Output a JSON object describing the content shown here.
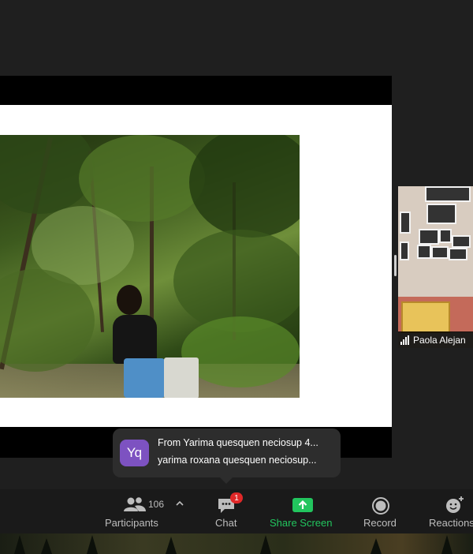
{
  "video": {
    "participant_name": "Paola Alejan"
  },
  "notification": {
    "avatar_initials": "Yq",
    "line1": "From Yarima quesquen neciosup 4...",
    "line2": "yarima roxana quesquen neciosup..."
  },
  "toolbar": {
    "participants_label": "Participants",
    "participants_count": "106",
    "chat_label": "Chat",
    "chat_badge": "1",
    "share_label": "Share Screen",
    "record_label": "Record",
    "reactions_label": "Reactions"
  },
  "colors": {
    "share_green": "#22c55e",
    "avatar_purple": "#7d52c1",
    "badge_red": "#e02828"
  }
}
